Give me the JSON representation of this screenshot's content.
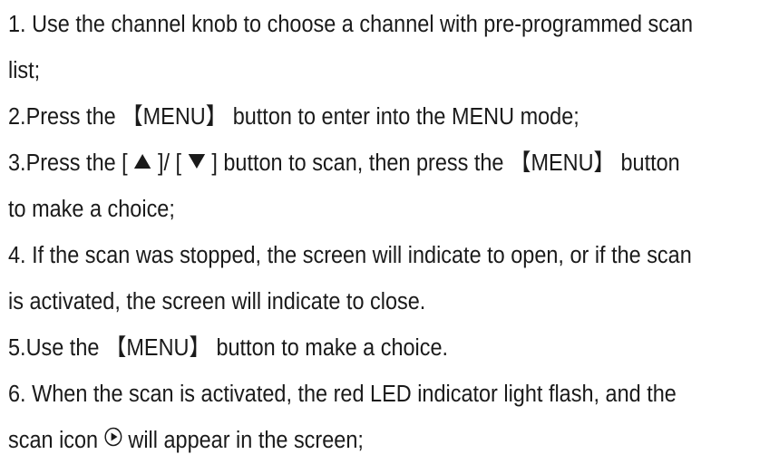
{
  "instructions": {
    "step1_a": "1. Use the channel knob to choose a channel with pre-programmed scan",
    "step1_b": "list;",
    "step2": "2.Press the 【MENU】 button to enter into the MENU mode;",
    "step3_a_pre": "3.Press the [ ",
    "step3_a_mid": " ]/ [ ",
    "step3_a_post": " ] button to scan, then press the 【MENU】 button",
    "step3_b": "to make a choice;",
    "step4_a": "4. If the scan was stopped, the screen will indicate to open, or if the scan",
    "step4_b": "is activated, the screen will indicate to close.",
    "step5": "5.Use the 【MENU】 button to make a choice.",
    "step6_a": "6. When the scan is activated, the red LED indicator light flash, and the",
    "step6_b_pre": "scan icon ",
    "step6_b_post": " will appear in the screen;"
  },
  "icons": {
    "up": "triangle-up-icon",
    "down": "triangle-down-icon",
    "scan": "play-circle-icon"
  }
}
